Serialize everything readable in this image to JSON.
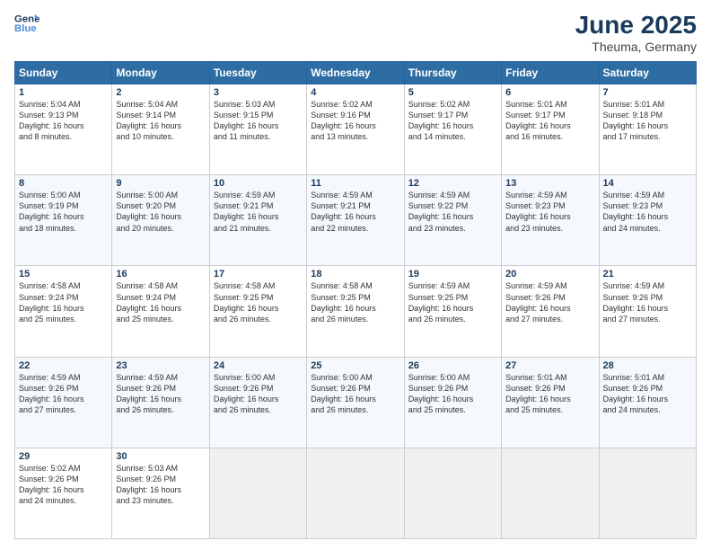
{
  "logo": {
    "line1": "General",
    "line2": "Blue"
  },
  "title": "June 2025",
  "subtitle": "Theuma, Germany",
  "days_header": [
    "Sunday",
    "Monday",
    "Tuesday",
    "Wednesday",
    "Thursday",
    "Friday",
    "Saturday"
  ],
  "weeks": [
    [
      {
        "day": "1",
        "info": "Sunrise: 5:04 AM\nSunset: 9:13 PM\nDaylight: 16 hours\nand 8 minutes."
      },
      {
        "day": "2",
        "info": "Sunrise: 5:04 AM\nSunset: 9:14 PM\nDaylight: 16 hours\nand 10 minutes."
      },
      {
        "day": "3",
        "info": "Sunrise: 5:03 AM\nSunset: 9:15 PM\nDaylight: 16 hours\nand 11 minutes."
      },
      {
        "day": "4",
        "info": "Sunrise: 5:02 AM\nSunset: 9:16 PM\nDaylight: 16 hours\nand 13 minutes."
      },
      {
        "day": "5",
        "info": "Sunrise: 5:02 AM\nSunset: 9:17 PM\nDaylight: 16 hours\nand 14 minutes."
      },
      {
        "day": "6",
        "info": "Sunrise: 5:01 AM\nSunset: 9:17 PM\nDaylight: 16 hours\nand 16 minutes."
      },
      {
        "day": "7",
        "info": "Sunrise: 5:01 AM\nSunset: 9:18 PM\nDaylight: 16 hours\nand 17 minutes."
      }
    ],
    [
      {
        "day": "8",
        "info": "Sunrise: 5:00 AM\nSunset: 9:19 PM\nDaylight: 16 hours\nand 18 minutes."
      },
      {
        "day": "9",
        "info": "Sunrise: 5:00 AM\nSunset: 9:20 PM\nDaylight: 16 hours\nand 20 minutes."
      },
      {
        "day": "10",
        "info": "Sunrise: 4:59 AM\nSunset: 9:21 PM\nDaylight: 16 hours\nand 21 minutes."
      },
      {
        "day": "11",
        "info": "Sunrise: 4:59 AM\nSunset: 9:21 PM\nDaylight: 16 hours\nand 22 minutes."
      },
      {
        "day": "12",
        "info": "Sunrise: 4:59 AM\nSunset: 9:22 PM\nDaylight: 16 hours\nand 23 minutes."
      },
      {
        "day": "13",
        "info": "Sunrise: 4:59 AM\nSunset: 9:23 PM\nDaylight: 16 hours\nand 23 minutes."
      },
      {
        "day": "14",
        "info": "Sunrise: 4:59 AM\nSunset: 9:23 PM\nDaylight: 16 hours\nand 24 minutes."
      }
    ],
    [
      {
        "day": "15",
        "info": "Sunrise: 4:58 AM\nSunset: 9:24 PM\nDaylight: 16 hours\nand 25 minutes."
      },
      {
        "day": "16",
        "info": "Sunrise: 4:58 AM\nSunset: 9:24 PM\nDaylight: 16 hours\nand 25 minutes."
      },
      {
        "day": "17",
        "info": "Sunrise: 4:58 AM\nSunset: 9:25 PM\nDaylight: 16 hours\nand 26 minutes."
      },
      {
        "day": "18",
        "info": "Sunrise: 4:58 AM\nSunset: 9:25 PM\nDaylight: 16 hours\nand 26 minutes."
      },
      {
        "day": "19",
        "info": "Sunrise: 4:59 AM\nSunset: 9:25 PM\nDaylight: 16 hours\nand 26 minutes."
      },
      {
        "day": "20",
        "info": "Sunrise: 4:59 AM\nSunset: 9:26 PM\nDaylight: 16 hours\nand 27 minutes."
      },
      {
        "day": "21",
        "info": "Sunrise: 4:59 AM\nSunset: 9:26 PM\nDaylight: 16 hours\nand 27 minutes."
      }
    ],
    [
      {
        "day": "22",
        "info": "Sunrise: 4:59 AM\nSunset: 9:26 PM\nDaylight: 16 hours\nand 27 minutes."
      },
      {
        "day": "23",
        "info": "Sunrise: 4:59 AM\nSunset: 9:26 PM\nDaylight: 16 hours\nand 26 minutes."
      },
      {
        "day": "24",
        "info": "Sunrise: 5:00 AM\nSunset: 9:26 PM\nDaylight: 16 hours\nand 26 minutes."
      },
      {
        "day": "25",
        "info": "Sunrise: 5:00 AM\nSunset: 9:26 PM\nDaylight: 16 hours\nand 26 minutes."
      },
      {
        "day": "26",
        "info": "Sunrise: 5:00 AM\nSunset: 9:26 PM\nDaylight: 16 hours\nand 25 minutes."
      },
      {
        "day": "27",
        "info": "Sunrise: 5:01 AM\nSunset: 9:26 PM\nDaylight: 16 hours\nand 25 minutes."
      },
      {
        "day": "28",
        "info": "Sunrise: 5:01 AM\nSunset: 9:26 PM\nDaylight: 16 hours\nand 24 minutes."
      }
    ],
    [
      {
        "day": "29",
        "info": "Sunrise: 5:02 AM\nSunset: 9:26 PM\nDaylight: 16 hours\nand 24 minutes."
      },
      {
        "day": "30",
        "info": "Sunrise: 5:03 AM\nSunset: 9:26 PM\nDaylight: 16 hours\nand 23 minutes."
      },
      {
        "day": "",
        "info": ""
      },
      {
        "day": "",
        "info": ""
      },
      {
        "day": "",
        "info": ""
      },
      {
        "day": "",
        "info": ""
      },
      {
        "day": "",
        "info": ""
      }
    ]
  ]
}
